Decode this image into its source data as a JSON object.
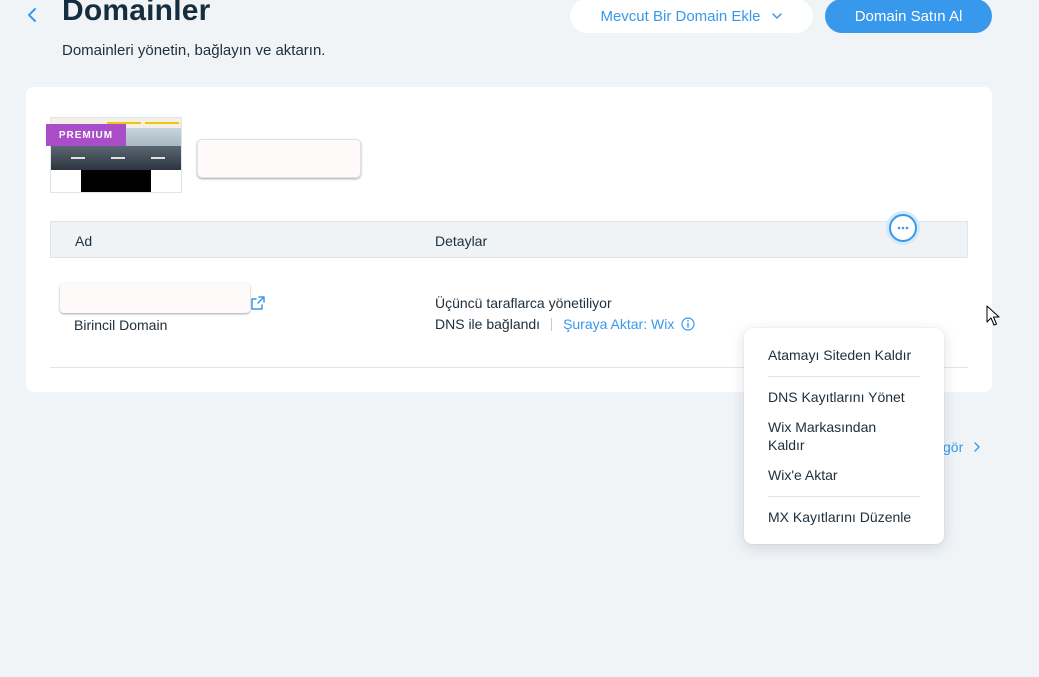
{
  "header": {
    "title": "Domainler",
    "subtitle": "Domainleri yönetin, bağlayın ve aktarın.",
    "add_existing_label": "Mevcut Bir Domain Ekle",
    "buy_domain_label": "Domain Satın Al"
  },
  "site": {
    "badge": "PREMIUM"
  },
  "table": {
    "columns": [
      "Ad",
      "Detaylar"
    ],
    "rows": [
      {
        "primary_label": "Birincil Domain",
        "managed_text": "Üçüncü taraflarca yönetiliyor",
        "connection_text": "DNS ile bağlandı",
        "transfer_link": "Şuraya Aktar: Wix"
      }
    ]
  },
  "see_all_label": "gör",
  "context_menu": {
    "items": [
      "Atamayı Siteden Kaldır",
      "DNS Kayıtlarını Yönet",
      "Wix Markasından Kaldır",
      "Wix'e Aktar",
      "MX Kayıtlarını Düzenle"
    ]
  },
  "colors": {
    "accent": "#3899ec",
    "background": "#f0f4f7",
    "premium": "#aa4dc8",
    "text": "#20303c"
  }
}
